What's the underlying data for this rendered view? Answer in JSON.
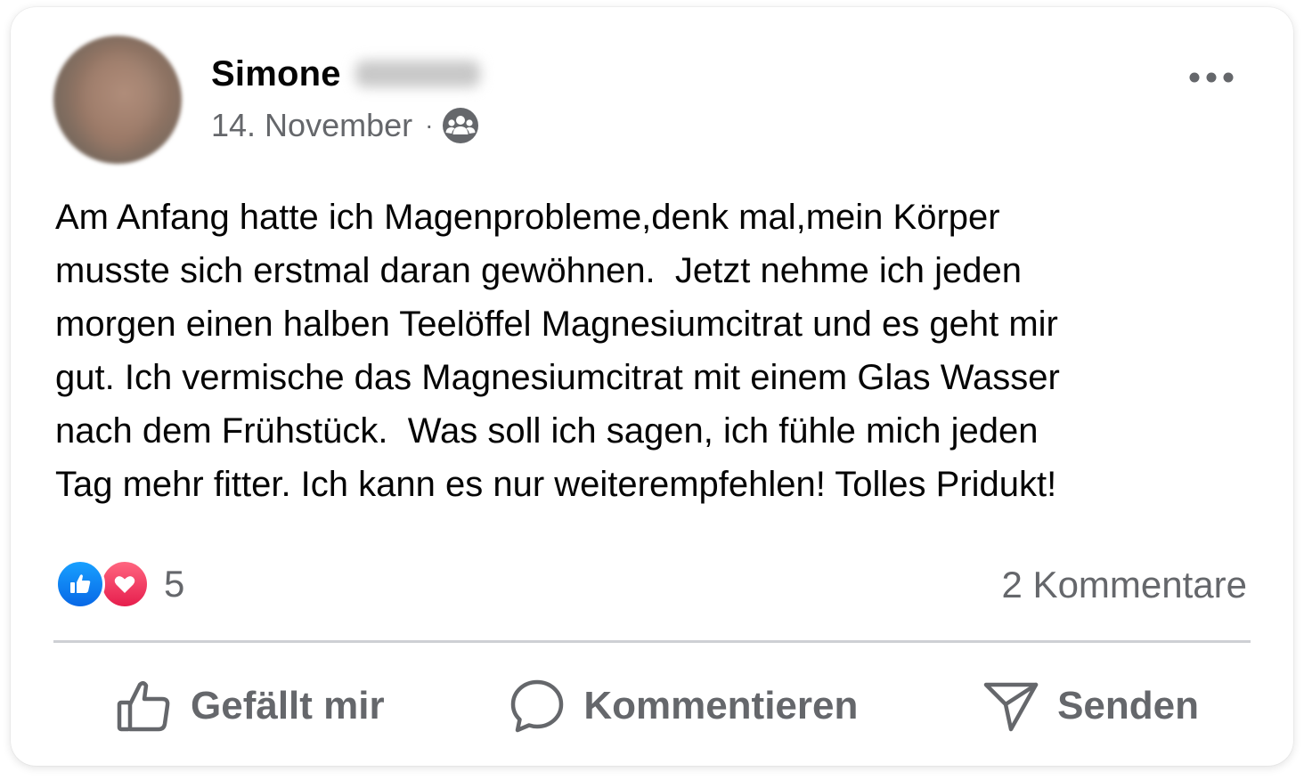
{
  "post": {
    "author": {
      "first_name": "Simone"
    },
    "date": "14. November",
    "separator": "·",
    "audience_icon": "friends-group-icon",
    "text": "Am Anfang hatte ich Magenprobleme,denk mal,mein Körper\nmusste sich erstmal daran gewöhnen.  Jetzt nehme ich jeden\nmorgen einen halben Teelöffel Magnesiumcitrat und es geht mir\ngut. Ich vermische das Magnesiumcitrat mit einem Glas Wasser\nnach dem Frühstück.  Was soll ich sagen, ich fühle mich jeden\nTag mehr fitter. Ich kann es nur weiterempfehlen! Tolles Pridukt!",
    "more_icon": "more-horizontal-icon"
  },
  "engagement": {
    "reaction_icons": [
      "like-reaction-icon",
      "love-reaction-icon"
    ],
    "reaction_count": "5",
    "comments": "2 Kommentare"
  },
  "actions": {
    "like": {
      "label": "Gefällt mir",
      "icon": "thumbs-up-icon"
    },
    "comment": {
      "label": "Kommentieren",
      "icon": "comment-bubble-icon"
    },
    "send": {
      "label": "Senden",
      "icon": "send-icon"
    }
  },
  "colors": {
    "text_primary": "#050505",
    "text_secondary": "#65676b",
    "like_blue": "#0866ff",
    "love_red": "#f33e58",
    "divider": "#ced0d4"
  }
}
